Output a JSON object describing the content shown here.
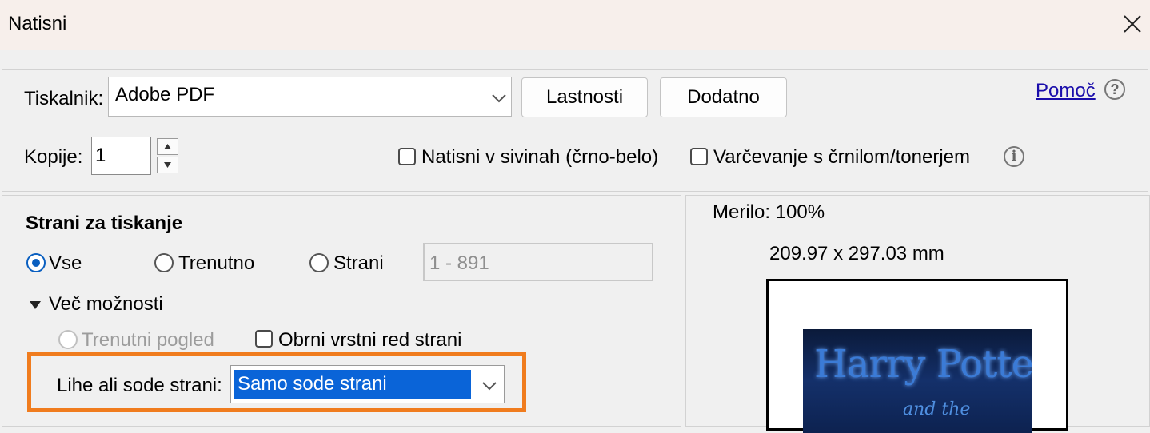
{
  "window": {
    "title": "Natisni"
  },
  "printer": {
    "label": "Tiskalnik:",
    "selected": "Adobe PDF",
    "properties_button": "Lastnosti",
    "advanced_button": "Dodatno",
    "help_link": "Pomoč",
    "help_icon": "question-circle-icon"
  },
  "copies": {
    "label": "Kopije:",
    "value": "1",
    "grayscale_label": "Natisni v sivinah (črno-belo)",
    "grayscale_checked": false,
    "save_ink_label": "Varčevanje s črnilom/tonerjem",
    "save_ink_checked": false,
    "info_icon": "info-circle-icon"
  },
  "pages": {
    "title": "Strani za tiskanje",
    "option_all": "Vse",
    "option_current": "Trenutno",
    "option_pages": "Strani",
    "selected_option": "Vse",
    "range_placeholder": "1 - 891",
    "more_options": "Več možnosti",
    "current_view": "Trenutni pogled",
    "current_view_enabled": false,
    "reverse_order": "Obrni vrstni red strani",
    "reverse_checked": false,
    "odd_even_label": "Lihe ali sode strani:",
    "odd_even_selected": "Samo sode strani"
  },
  "preview": {
    "scale": "Merilo: 100%",
    "size": "209.97 x 297.03 mm",
    "cover_title": "Harry Potter",
    "cover_subtitle": "and the"
  },
  "colors": {
    "highlight_outline": "#f07c1e",
    "selection": "#0a64d8",
    "link": "#1a0dab"
  }
}
